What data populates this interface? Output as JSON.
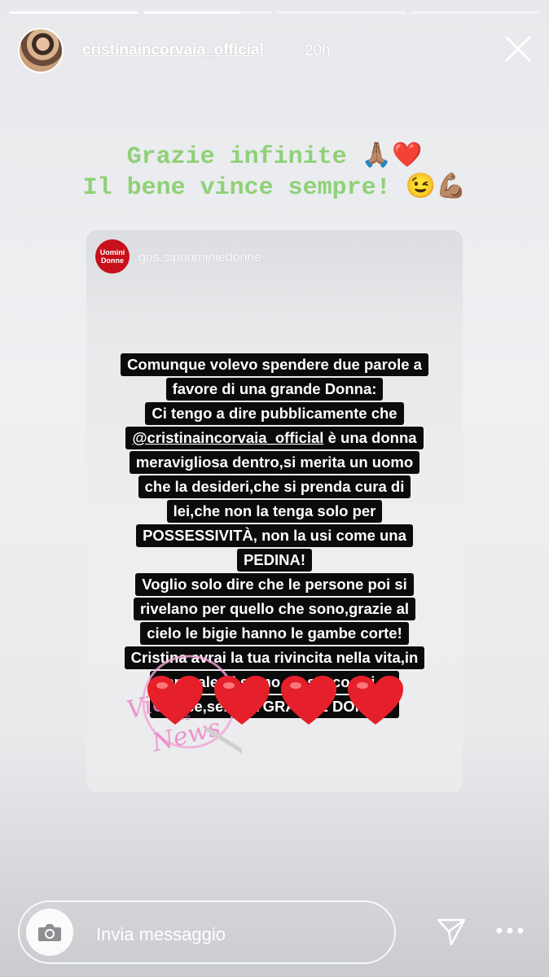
{
  "story": {
    "progress_segments": [
      1,
      0.75,
      0,
      0
    ]
  },
  "header": {
    "username": "cristinaincorvaia_official",
    "time": "20h",
    "close_icon": "close-icon"
  },
  "caption": {
    "line1": "Grazie infinite 🙏🏽❤️",
    "line2": "Il bene vince sempre! 😉💪🏽",
    "color": "#8fd177"
  },
  "shared_post": {
    "logo_text": "Uomini Donne",
    "handle": "gos.sipuominiedonne",
    "lines": [
      "Comunque volevo spendere due parole a",
      "favore di una grande Donna:",
      "Ci tengo a dire pubblicamente che",
      "@cristinaincorvaia_official è  una donna",
      "meravigliosa dentro,si merita un uomo",
      "che la desideri,che si prenda cura di",
      "lei,che non la tenga solo per",
      "POSSESSIVITÀ, non la usi come una",
      "PEDINA!",
      "Voglio solo dire che le persone poi si",
      "rivelano per quello che sono,grazie al",
      "cielo le bigie hanno le gambe corte!",
      "Cristina avrai la tua rivincita nella vita,in",
      "generale, ti stimo un sacco,sei di",
      "classe,sei una GRANDE DONNA!"
    ],
    "mention": "@cristinaincorvaia_official",
    "hearts_count": 4,
    "heart_color": "#e5202a",
    "watermark": "Vicolo delle News"
  },
  "bottom_bar": {
    "placeholder": "Invia messaggio",
    "camera_icon": "camera-icon",
    "send_icon": "send-icon",
    "more_icon": "more-icon"
  }
}
